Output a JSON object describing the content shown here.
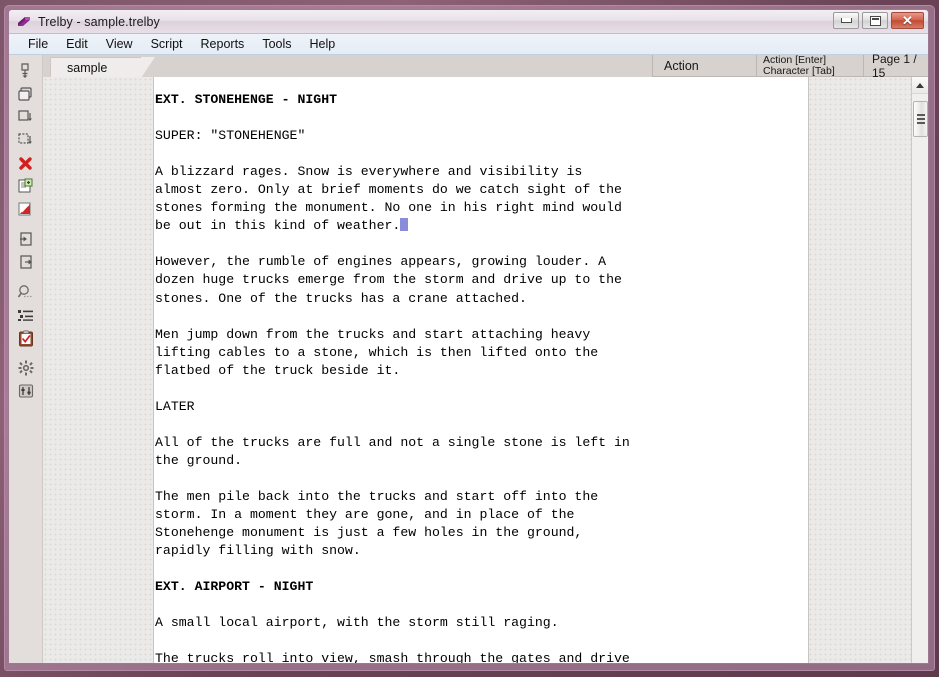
{
  "window": {
    "title": "Trelby - sample.trelby",
    "app_icon": "trelby-logo-icon",
    "controls": {
      "minimize": "minimize-icon",
      "maximize": "maximize-icon",
      "close": "✕"
    }
  },
  "menubar": {
    "items": [
      {
        "label": "File"
      },
      {
        "label": "Edit"
      },
      {
        "label": "View"
      },
      {
        "label": "Script"
      },
      {
        "label": "Reports"
      },
      {
        "label": "Tools"
      },
      {
        "label": "Help"
      }
    ]
  },
  "toolbar": {
    "items": [
      {
        "name": "new-script-icon",
        "tip": "New"
      },
      {
        "name": "open-script-icon",
        "tip": "Open"
      },
      {
        "name": "save-script-icon",
        "tip": "Save"
      },
      {
        "name": "save-as-icon",
        "tip": "Save As"
      },
      {
        "name": "close-script-icon",
        "tip": "Close"
      },
      {
        "name": "export-rtf-icon",
        "tip": "Export"
      },
      {
        "name": "export-pdf-icon",
        "tip": "Print / PDF"
      },
      {
        "name": "import-icon",
        "tip": "Import"
      },
      {
        "name": "export-out-icon",
        "tip": "Export out"
      },
      {
        "name": "find-icon",
        "tip": "Find"
      },
      {
        "name": "scene-list-icon",
        "tip": "Scene list"
      },
      {
        "name": "spell-check-icon",
        "tip": "Spell check"
      },
      {
        "name": "settings-gear-icon",
        "tip": "Settings"
      },
      {
        "name": "script-settings-icon",
        "tip": "Script settings"
      }
    ]
  },
  "tabs": [
    {
      "label": "sample",
      "active": true
    }
  ],
  "statusbar": {
    "element_type": "Action",
    "key_hint_line1": "Action [Enter]",
    "key_hint_line2": "Character [Tab]",
    "page_indicator": "Page 1 / 15"
  },
  "script": {
    "lines": [
      {
        "text": "EXT. STONEHENGE - NIGHT",
        "bold": true
      },
      {
        "text": "",
        "bold": false
      },
      {
        "text": "SUPER: \"STONEHENGE\"",
        "bold": false
      },
      {
        "text": "",
        "bold": false
      },
      {
        "text": "A blizzard rages. Snow is everywhere and visibility is",
        "bold": false
      },
      {
        "text": "almost zero. Only at brief moments do we catch sight of the",
        "bold": false
      },
      {
        "text": "stones forming the monument. No one in his right mind would",
        "bold": false
      },
      {
        "text": "be out in this kind of weather.",
        "bold": false,
        "caret": true
      },
      {
        "text": "",
        "bold": false
      },
      {
        "text": "However, the rumble of engines appears, growing louder. A",
        "bold": false
      },
      {
        "text": "dozen huge trucks emerge from the storm and drive up to the",
        "bold": false
      },
      {
        "text": "stones. One of the trucks has a crane attached.",
        "bold": false
      },
      {
        "text": "",
        "bold": false
      },
      {
        "text": "Men jump down from the trucks and start attaching heavy",
        "bold": false
      },
      {
        "text": "lifting cables to a stone, which is then lifted onto the",
        "bold": false
      },
      {
        "text": "flatbed of the truck beside it.",
        "bold": false
      },
      {
        "text": "",
        "bold": false
      },
      {
        "text": "LATER",
        "bold": false
      },
      {
        "text": "",
        "bold": false
      },
      {
        "text": "All of the trucks are full and not a single stone is left in",
        "bold": false
      },
      {
        "text": "the ground.",
        "bold": false
      },
      {
        "text": "",
        "bold": false
      },
      {
        "text": "The men pile back into the trucks and start off into the",
        "bold": false
      },
      {
        "text": "storm. In a moment they are gone, and in place of the",
        "bold": false
      },
      {
        "text": "Stonehenge monument is just a few holes in the ground,",
        "bold": false
      },
      {
        "text": "rapidly filling with snow.",
        "bold": false
      },
      {
        "text": "",
        "bold": false
      },
      {
        "text": "EXT. AIRPORT - NIGHT",
        "bold": true
      },
      {
        "text": "",
        "bold": false
      },
      {
        "text": "A small local airport, with the storm still raging.",
        "bold": false
      },
      {
        "text": "",
        "bold": false
      },
      {
        "text": "The trucks roll into view, smash through the gates and drive",
        "bold": false
      }
    ]
  },
  "colors": {
    "caret": "#8b8bdb",
    "page": "#ffffff",
    "frame": "#b489a8",
    "close_button": "#c04b35",
    "logo": "#8e2f8e"
  }
}
